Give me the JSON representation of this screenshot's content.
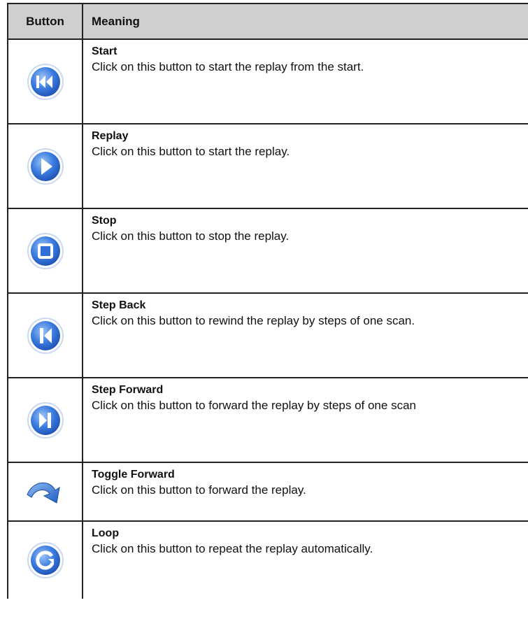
{
  "header": {
    "button_col": "Button",
    "meaning_col": "Meaning"
  },
  "rows": [
    {
      "icon": "rewind-to-start-icon",
      "title": "Start",
      "desc": "Click on this button to start the replay from the start."
    },
    {
      "icon": "play-icon",
      "title": "Replay",
      "desc": "Click on this button to start the replay."
    },
    {
      "icon": "stop-icon",
      "title": "Stop",
      "desc": "Click on this button to stop the replay."
    },
    {
      "icon": "step-back-icon",
      "title": "Step Back",
      "desc": "Click on this button to rewind the replay by steps of one scan."
    },
    {
      "icon": "step-forward-icon",
      "title": "Step Forward",
      "desc": "Click on this button to forward the replay by steps of one scan"
    },
    {
      "icon": "curved-arrow-icon",
      "title": "Toggle Forward",
      "desc": "Click on this button to forward the replay."
    },
    {
      "icon": "loop-icon",
      "title": "Loop",
      "desc": "Click on this button to repeat the replay automatically."
    }
  ],
  "colors": {
    "icon_blue": "#2f6fd6",
    "icon_light": "#a8c8f4",
    "header_bg": "#cfcfcf"
  }
}
